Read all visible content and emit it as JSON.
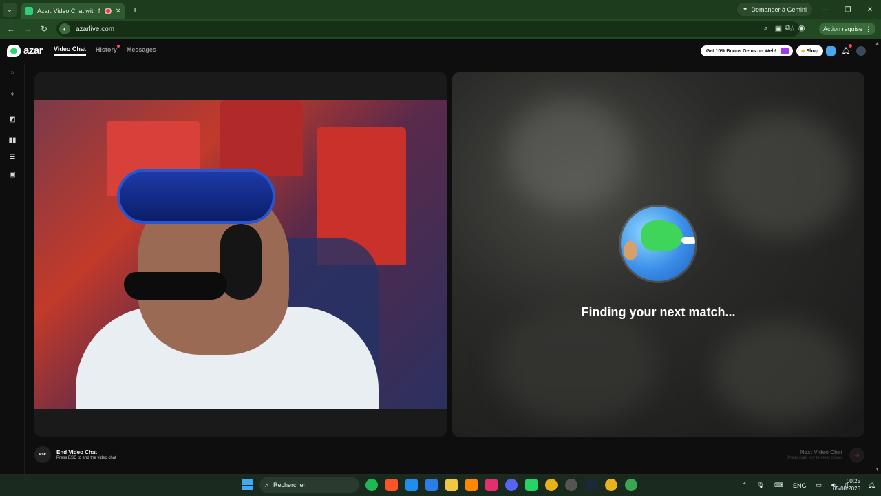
{
  "browser": {
    "tab_title": "Azar: Video Chat with New",
    "url": "azarlive.com",
    "gemini_label": "Demander à Gemini",
    "action_required": "Action requise"
  },
  "app": {
    "logo": "azar",
    "nav": {
      "video_chat": "Video Chat",
      "history": "History",
      "messages": "Messages"
    },
    "gems_label": "Get 10% Bonus Gems on Web!",
    "shop_label": "Shop"
  },
  "match": {
    "status": "Finding your next match..."
  },
  "controls": {
    "esc_key": "esc",
    "end_title": "End Video Chat",
    "end_sub": "Press ESC to end the video chat",
    "next_title": "Next Video Chat",
    "next_sub": "Press right key to meet others"
  },
  "taskbar": {
    "search_placeholder": "Rechercher",
    "lang": "ENG",
    "time": "00:25",
    "date": "05/08/2026"
  },
  "colors": {
    "accent": "#2bd46f",
    "chrome_green": "#1d3b1d"
  }
}
